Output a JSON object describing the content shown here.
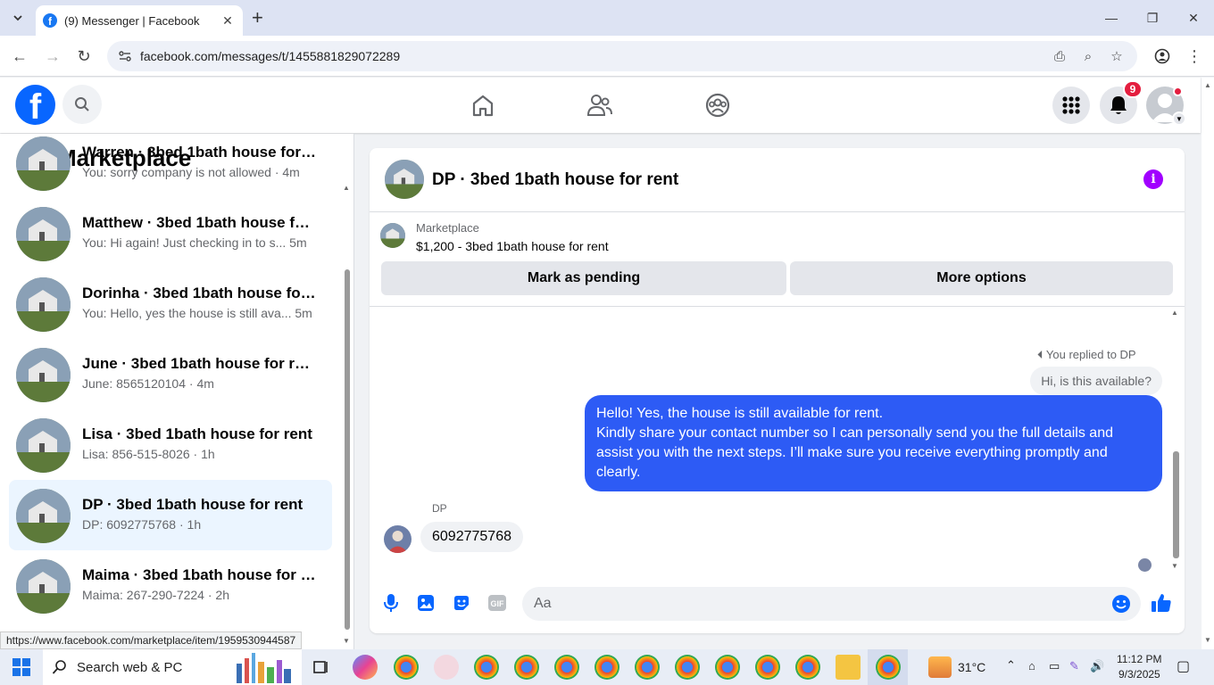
{
  "browser": {
    "tab_title": "(9) Messenger | Facebook",
    "url": "facebook.com/messages/t/1455881829072289",
    "status_url": "https://www.facebook.com/marketplace/item/1959530944587"
  },
  "header": {
    "notification_count": "9"
  },
  "sidebar": {
    "title": "Marketplace",
    "conversations": [
      {
        "name": "Warren · 3bed 1bath house for r...",
        "snippet": "You: sorry company is not allowed · 4m"
      },
      {
        "name": "Matthew · 3bed 1bath house for ...",
        "snippet": "You: Hi again! Just checking in to s...   5m"
      },
      {
        "name": "Dorinha · 3bed 1bath house for r...",
        "snippet": "You: Hello, yes the house is still ava...   5m"
      },
      {
        "name": "June · 3bed 1bath house for rent",
        "snippet": "June: 8565120104 · 4m"
      },
      {
        "name": "Lisa · 3bed 1bath house for rent",
        "snippet": "Lisa: 856-515-8026 · 1h"
      },
      {
        "name": "DP · 3bed 1bath house for rent",
        "snippet": "DP: 6092775768 · 1h"
      },
      {
        "name": "Maima · 3bed 1bath house for re...",
        "snippet": "Maima: 267-290-7224 · 2h"
      }
    ]
  },
  "chat": {
    "title": "DP · 3bed 1bath house for rent",
    "listing_label": "Marketplace",
    "listing_price": "$1,200 - 3bed 1bath house for rent",
    "mark_pending": "Mark as pending",
    "more_options": "More options",
    "replied_to": "You replied to DP",
    "quoted_message": "Hi, is this available?",
    "sent_message_line1": "Hello! Yes, the house is still available for rent.",
    "sent_message_line2": "Kindly share your contact number so I can personally send you the full details and assist you with the next steps. I’ll make sure you receive everything promptly and clearly.",
    "sender_name": "DP",
    "received_message": "6092775768",
    "input_placeholder": "Aa"
  },
  "taskbar": {
    "search_label": "Search web & PC",
    "temperature": "31°C",
    "time": "11:12 PM",
    "date": "9/3/2025"
  },
  "colors": {
    "facebook_blue": "#0866ff",
    "sent_bubble": "#2d5bf5",
    "active_row": "#ebf5ff",
    "badge_red": "#e41e3f"
  }
}
